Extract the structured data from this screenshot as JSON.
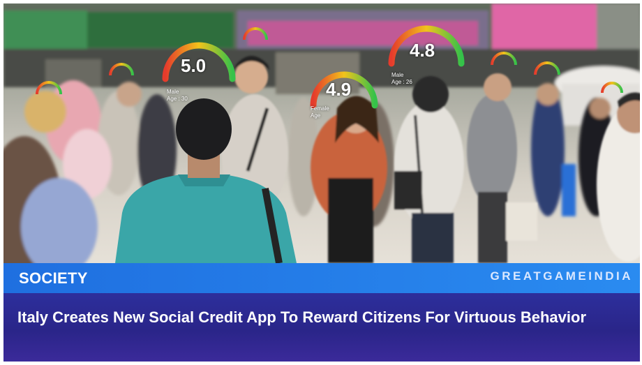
{
  "image": {
    "scene": "busy city street crowd with face-recognition rating overlays",
    "overlays": [
      {
        "score": "5.0",
        "gender": "Male",
        "age": "Age : 30"
      },
      {
        "score": "4.9",
        "gender": "Female",
        "age": "Age"
      },
      {
        "score": "4.8",
        "gender": "Male",
        "age": "Age : 26"
      }
    ]
  },
  "banner": {
    "category": "SOCIETY",
    "brand": "GREATGAMEINDIA",
    "headline": "Italy Creates New Social Credit App To Reward Citizens For Virtuous Behavior"
  },
  "colors": {
    "category_bar": "#1f6fe0",
    "headline_panel": "#2a2589",
    "gauge_red": "#e53b2c",
    "gauge_yellow": "#f2c31b",
    "gauge_green": "#35c24a"
  }
}
